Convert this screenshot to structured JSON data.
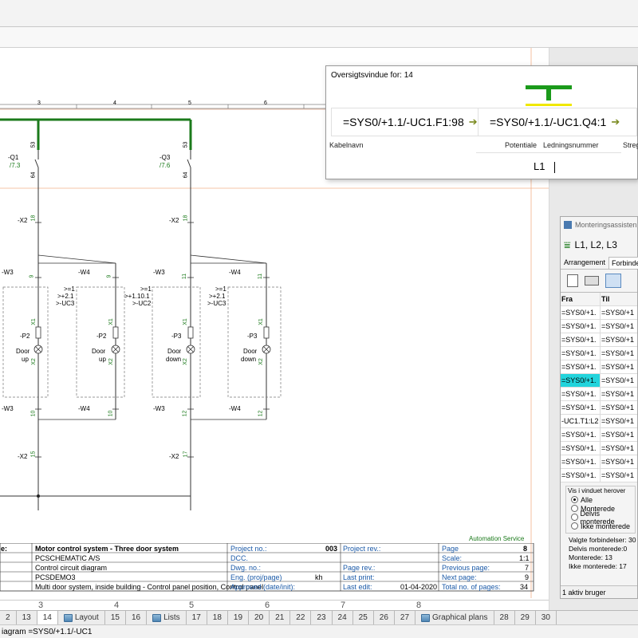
{
  "overview": {
    "title": "Oversigtsvindue for: 14",
    "terminal_left": "=SYS0/+1.1/-UC1.F1:98",
    "terminal_right": "=SYS0/+1.1/-UC1.Q4:1",
    "col_kabelnavn": "Kabelnavn",
    "col_potentiale": "Potentiale",
    "col_ledningsnummer": "Ledningsnummer",
    "col_streg": "Streg",
    "potential_value": "L1"
  },
  "schematic": {
    "col_numbers": [
      "3",
      "4",
      "5",
      "6"
    ],
    "q1_label": "-Q1",
    "q1_ref": "/7.3",
    "q3_label": "-Q3",
    "q3_ref": "/7.6",
    "terminal_53": "53",
    "terminal_64": "64",
    "x2a": "-X2",
    "x2b": "-X2",
    "x2c": "-X2",
    "x2d": "-X2",
    "t18a": "18",
    "t18b": "18",
    "t15": "15",
    "t17": "17",
    "w3a": "-W3",
    "w4a": "-W4",
    "w3b": "-W3",
    "w4b": "-W4",
    "w3c": "-W3",
    "w4c": "-W4",
    "w3d": "-W3",
    "w4d": "-W4",
    "n9a": "9",
    "n9b": "9",
    "n11a": "11",
    "n11b": "11",
    "n10a": "10",
    "n10b": "10",
    "n12a": "12",
    "n12b": "12",
    "ref1a": ">=1",
    "ref1b": ">+2.1",
    "ref1c": ">-UC3",
    "ref2a": ">=1",
    "ref2b": ">+1.10.1",
    "ref2c": ">-UC2",
    "ref3a": ">=1",
    "ref3b": ">+2.1",
    "ref3c": ">-UC3",
    "p2a": "-P2",
    "p2b": "-P2",
    "p3a": "-P3",
    "p3b": "-P3",
    "x1": "X1",
    "x2": "X2",
    "door_up_a": "Door",
    "door_up_a2": "up",
    "door_up_b": "Door",
    "door_up_b2": "up",
    "door_dn_a": "Door",
    "door_dn_a2": "down",
    "door_dn_b": "Door",
    "door_dn_b2": "down"
  },
  "title_block": {
    "automation_service": "Automation Service",
    "left_cut": [
      "e:",
      "",
      "",
      "",
      ""
    ],
    "title": "Motor control system - Three door system",
    "company": "PCSCHEMATIC A/S",
    "subtitle": "Control circuit diagram",
    "drawing": "PCSDEMO3",
    "description": "Multi door system, inside building - Control panel position, Control panel",
    "project_no_label": "Project no.:",
    "project_no": "003",
    "dcc_label": "DCC.",
    "dwg_label": "Dwg. no.:",
    "eng_label": "Eng. (proj/page)",
    "eng_value": "kh",
    "approved_label": "Approved (date/init):",
    "project_rev_label": "Project rev.:",
    "page_rev_label": "Page rev.:",
    "last_print_label": "Last print:",
    "last_edit_label": "Last edit:",
    "last_edit": "01-04-2020",
    "page_label": "Page",
    "page_value": "8",
    "scale_label": "Scale:",
    "scale_value": "1:1",
    "prev_label": "Previous page:",
    "prev_value": "7",
    "next_label": "Next page:",
    "next_value": "9",
    "total_label": "Total no. of pages:",
    "total_value": "34"
  },
  "assistant": {
    "title": "Monteringsassisten",
    "heading": "L1, L2, L3",
    "tab_arrangement": "Arrangement",
    "tab_forbindelser": "Forbinde",
    "col_fra": "Fra",
    "col_til": "Til",
    "rows": [
      {
        "fra": "=SYS0/+1.",
        "til": "=SYS0/+1"
      },
      {
        "fra": "=SYS0/+1.",
        "til": "=SYS0/+1"
      },
      {
        "fra": "=SYS0/+1.",
        "til": "=SYS0/+1"
      },
      {
        "fra": "=SYS0/+1.",
        "til": "=SYS0/+1"
      },
      {
        "fra": "=SYS0/+1.",
        "til": "=SYS0/+1"
      },
      {
        "fra": "=SYS0/+1.",
        "til": "=SYS0/+1"
      },
      {
        "fra": "=SYS0/+1.",
        "til": "=SYS0/+1"
      },
      {
        "fra": "=SYS0/+1.",
        "til": "=SYS0/+1"
      },
      {
        "fra": "-UC1.T1:L2",
        "til": "=SYS0/+1"
      },
      {
        "fra": "=SYS0/+1.",
        "til": "=SYS0/+1"
      },
      {
        "fra": "=SYS0/+1.",
        "til": "=SYS0/+1"
      },
      {
        "fra": "=SYS0/+1.",
        "til": "=SYS0/+1"
      },
      {
        "fra": "=SYS0/+1.",
        "til": "=SYS0/+1"
      }
    ],
    "group_label": "Vis i vinduet herover",
    "opt_alle": "Alle",
    "opt_monterede": "Monterede",
    "opt_delvis": "Delvis monterede",
    "opt_ikke": "Ikke monterede",
    "stat_valgte": "Valgte forbindelser: 30",
    "stat_delvis": "Delvis monterede:0",
    "stat_monterede": "Monterede: 13",
    "stat_ikke": "Ikke monterede:  17",
    "active_users": "1 aktiv bruger"
  },
  "tabs": [
    "2",
    "13",
    "14",
    "Layout",
    "15",
    "16",
    "Lists",
    "17",
    "18",
    "19",
    "20",
    "21",
    "22",
    "23",
    "24",
    "25",
    "26",
    "27",
    "Graphical plans",
    "28",
    "29",
    "30"
  ],
  "ruler_numbers": [
    "3",
    "4",
    "5",
    "6",
    "7",
    "8"
  ],
  "status": "iagram  =SYS0/+1.1/-UC1",
  "colors": {
    "accent_green": "#1b7a1b",
    "selection": "#22d4dc",
    "yellow": "#f0e800"
  }
}
